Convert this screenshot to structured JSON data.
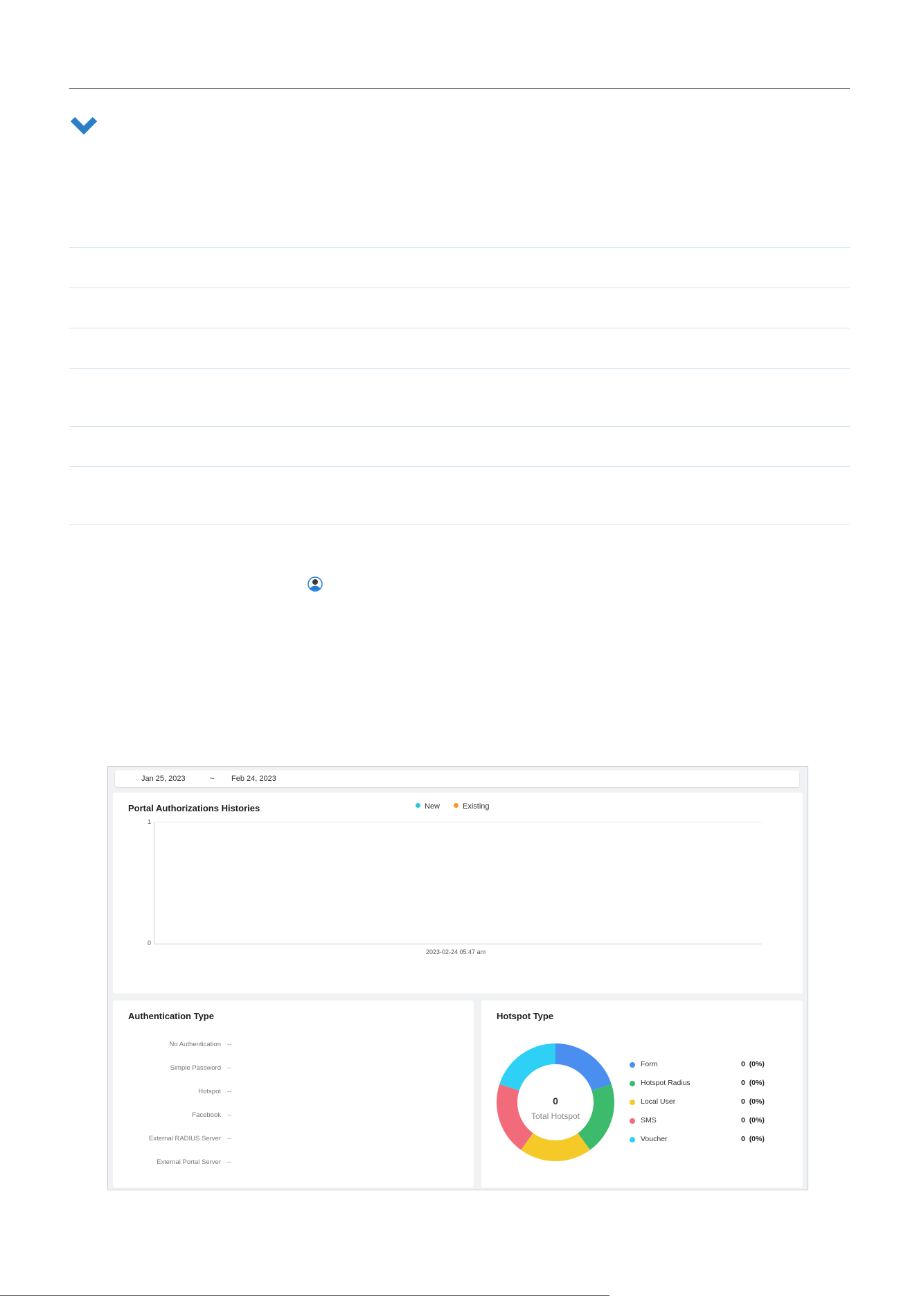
{
  "date_range": {
    "start": "Jan 25, 2023",
    "separator": "~",
    "end": "Feb 24, 2023"
  },
  "history": {
    "title": "Portal Authorizations Histories",
    "legend": [
      {
        "label": "New",
        "color": "#2ec7d9"
      },
      {
        "label": "Existing",
        "color": "#f59a23"
      }
    ],
    "y_ticks": [
      "1",
      "0"
    ],
    "x_label": "2023-02-24 05:47 am"
  },
  "auth_type": {
    "title": "Authentication Type",
    "rows": [
      {
        "label": "No Authentication",
        "value": "--"
      },
      {
        "label": "Simple Password",
        "value": "--"
      },
      {
        "label": "Hotspot",
        "value": "--"
      },
      {
        "label": "Facebook",
        "value": "--"
      },
      {
        "label": "External RADIUS Server",
        "value": "--"
      },
      {
        "label": "External Portal Server",
        "value": "--"
      }
    ]
  },
  "hotspot_type": {
    "title": "Hotspot Type",
    "total_value": "0",
    "total_label": "Total Hotspot",
    "items": [
      {
        "label": "Form",
        "value": "0",
        "pct": "(0%)",
        "color": "#4a8ff0"
      },
      {
        "label": "Hotspot Radius",
        "value": "0",
        "pct": "(0%)",
        "color": "#3dbb6c"
      },
      {
        "label": "Local User",
        "value": "0",
        "pct": "(0%)",
        "color": "#f5c928"
      },
      {
        "label": "SMS",
        "value": "0",
        "pct": "(0%)",
        "color": "#f26b7a"
      },
      {
        "label": "Voucher",
        "value": "0",
        "pct": "(0%)",
        "color": "#2ed1f5"
      }
    ]
  },
  "icons": {
    "expand": "chevron-down-icon",
    "person": "user-icon"
  },
  "accent_color": "#2a7fc6"
}
